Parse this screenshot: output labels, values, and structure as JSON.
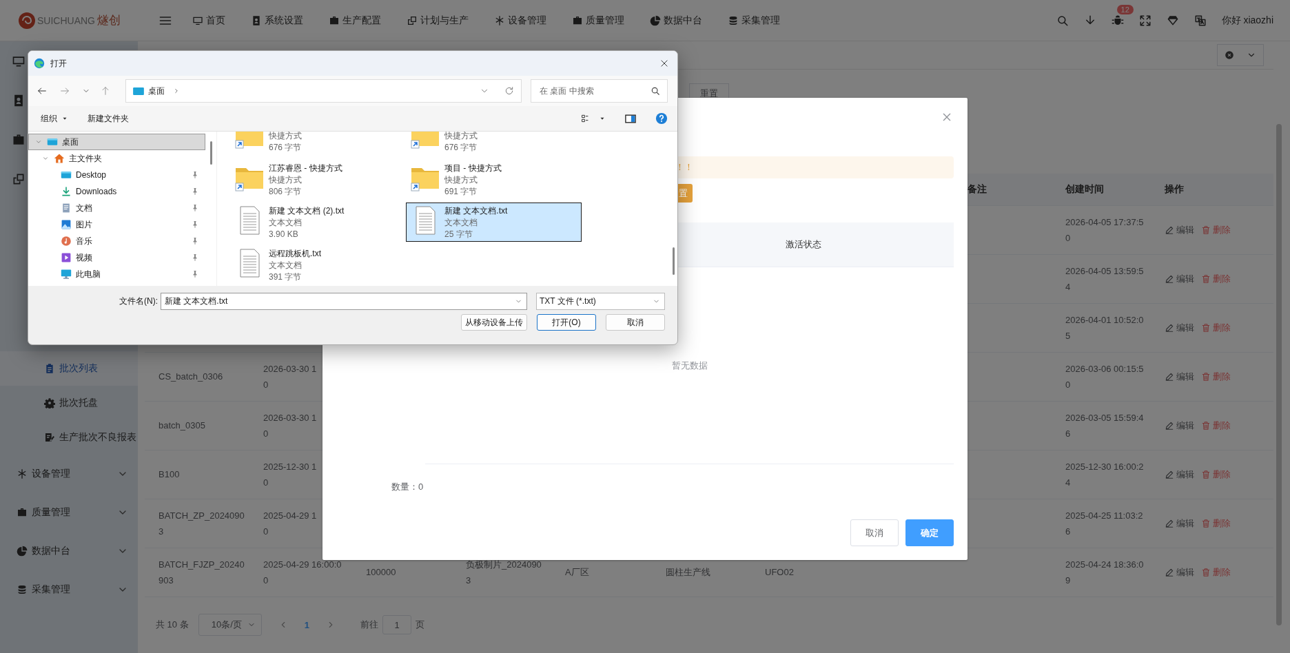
{
  "header": {
    "logo": {
      "name": "SUICHUANG",
      "name_cn": "燧创"
    },
    "nav": [
      {
        "label": "首页",
        "kind": "monitor"
      },
      {
        "label": "系统设置",
        "kind": "contact"
      },
      {
        "label": "生产配置",
        "kind": "briefcase"
      },
      {
        "label": "计划与生产",
        "kind": "windows"
      },
      {
        "label": "设备管理",
        "kind": "asterisk"
      },
      {
        "label": "质量管理",
        "kind": "briefcase"
      },
      {
        "label": "数据中台",
        "kind": "pie"
      },
      {
        "label": "采集管理",
        "kind": "database"
      }
    ],
    "notification_count": "12",
    "greeting": "你好 xiaozhi"
  },
  "sidebar": {
    "top_items": [
      {
        "kind": "monitor"
      },
      {
        "kind": "contact"
      },
      {
        "kind": "briefcase"
      },
      {
        "kind": "windows"
      }
    ],
    "submenu": [
      {
        "label": "批次列表",
        "kind": "clipboard",
        "selected": true
      },
      {
        "label": "批次托盘",
        "kind": "gear",
        "selected": false
      },
      {
        "label": "生产批次不良报表",
        "kind": "report",
        "selected": false
      }
    ],
    "menus": [
      {
        "label": "设备管理",
        "kind": "asterisk",
        "expanded": false
      },
      {
        "label": "质量管理",
        "kind": "briefcase",
        "expanded": false
      },
      {
        "label": "数据中台",
        "kind": "pie",
        "expanded": false
      },
      {
        "label": "采集管理",
        "kind": "database",
        "expanded": false
      }
    ]
  },
  "search": {
    "reset_button": "重置"
  },
  "table": {
    "headers": [
      "备注",
      "创建时间",
      "操作"
    ],
    "rows": [
      {
        "created": "2026-04-05 17:37:5\n0",
        "edit": "编辑",
        "delete": "删除"
      },
      {
        "created": "2026-04-05 13:59:5\n4",
        "edit": "编辑",
        "delete": "删除"
      },
      {
        "created": "2026-04-01 10:52:0\n5",
        "edit": "编辑",
        "delete": "删除"
      },
      {
        "name": "CS_batch_0306",
        "time": "2026-03-30 1\n0",
        "created": "2026-03-06 00:15:5\n0",
        "edit": "编辑",
        "delete": "删除"
      },
      {
        "name": "batch_0305",
        "time": "2026-03-30 1\n0",
        "created": "2026-03-05 15:59:4\n6",
        "edit": "编辑",
        "delete": "删除"
      },
      {
        "name": "B100",
        "time": "2025-12-30 1\n0",
        "created": "2025-12-30 16:00:2\n4",
        "edit": "编辑",
        "delete": "删除"
      },
      {
        "name": "BATCH_ZP_2024090\n3",
        "time": "2025-04-29 1\n0",
        "created": "2025-04-25 11:03:2\n6",
        "edit": "编辑",
        "delete": "删除"
      },
      {
        "name": "BATCH_FJZP_20240\n903",
        "time": "2025-04-29 16:00:0\n0",
        "quantity": "100000",
        "product": "负极制片_2024090\n3",
        "factory": "A厂区",
        "line": "圆柱生产线",
        "equipment": "UFO02",
        "created": "2025-04-24 18:36:0\n9",
        "edit": "编辑",
        "delete": "删除"
      }
    ]
  },
  "pagination": {
    "total": "共 10 条",
    "page_size": "10条/页",
    "current_page": "1",
    "goto_label": "前往",
    "goto_value": "1",
    "page_suffix": "页"
  },
  "modal": {
    "alert": "！！",
    "action_button": "置",
    "table_header": "激活状态",
    "empty_text": "暂无数据",
    "count_label": "数量：0",
    "buttons": [
      {
        "label": "取消",
        "kind": "default"
      },
      {
        "label": "确定",
        "kind": "primary"
      }
    ]
  },
  "file_dialog": {
    "title": "打开",
    "address": "桌面",
    "search_placeholder": "在 桌面 中搜索",
    "toolbar": [
      {
        "label": "组织",
        "kind": "menu"
      },
      {
        "label": "新建文件夹",
        "kind": "command"
      }
    ],
    "tree": [
      {
        "label": "桌面",
        "kind": "desktop",
        "selected": true,
        "expanded": true,
        "children": [
          {
            "label": "主文件夹",
            "kind": "home",
            "selected": false,
            "expanded": true,
            "children": [
              {
                "label": "Desktop",
                "kind": "desktop",
                "selected": false,
                "pinned": true
              },
              {
                "label": "Downloads",
                "kind": "downloads",
                "selected": false,
                "pinned": true
              },
              {
                "label": "文档",
                "kind": "documents",
                "selected": false,
                "pinned": true
              },
              {
                "label": "图片",
                "kind": "pictures",
                "selected": false,
                "pinned": true
              },
              {
                "label": "音乐",
                "kind": "music",
                "selected": false,
                "pinned": true
              },
              {
                "label": "视频",
                "kind": "videos",
                "selected": false,
                "pinned": true
              },
              {
                "label": "此电脑",
                "kind": "pc",
                "selected": false,
                "pinned": true
              }
            ]
          }
        ]
      }
    ],
    "files": [
      {
        "type": "快捷方式",
        "size": "676 字节",
        "kind": "folder-shortcut",
        "selected": false
      },
      {
        "type": "快捷方式",
        "size": "676 字节",
        "kind": "folder-shortcut",
        "selected": false
      },
      {
        "name": "江苏睿恩 - 快捷方式",
        "type": "快捷方式",
        "size": "806 字节",
        "kind": "folder-shortcut",
        "selected": false
      },
      {
        "name": "项目 - 快捷方式",
        "type": "快捷方式",
        "size": "691 字节",
        "kind": "folder-shortcut",
        "selected": false
      },
      {
        "name": "新建 文本文档 (2).txt",
        "type": "文本文档",
        "size": "3.90 KB",
        "kind": "text",
        "selected": false
      },
      {
        "name": "新建 文本文档.txt",
        "type": "文本文档",
        "size": "25 字节",
        "kind": "text",
        "selected": true
      },
      {
        "name": "远程跳板机.txt",
        "type": "文本文档",
        "size": "391 字节",
        "kind": "text",
        "selected": false
      }
    ],
    "filename_label": "文件名(N):",
    "filename_value": "新建 文本文档.txt",
    "filter": "TXT 文件 (*.txt)",
    "buttons": [
      {
        "label": "从移动设备上传",
        "kind": "default"
      },
      {
        "label": "打开(O)",
        "kind": "primary"
      },
      {
        "label": "取消",
        "kind": "default"
      }
    ]
  }
}
